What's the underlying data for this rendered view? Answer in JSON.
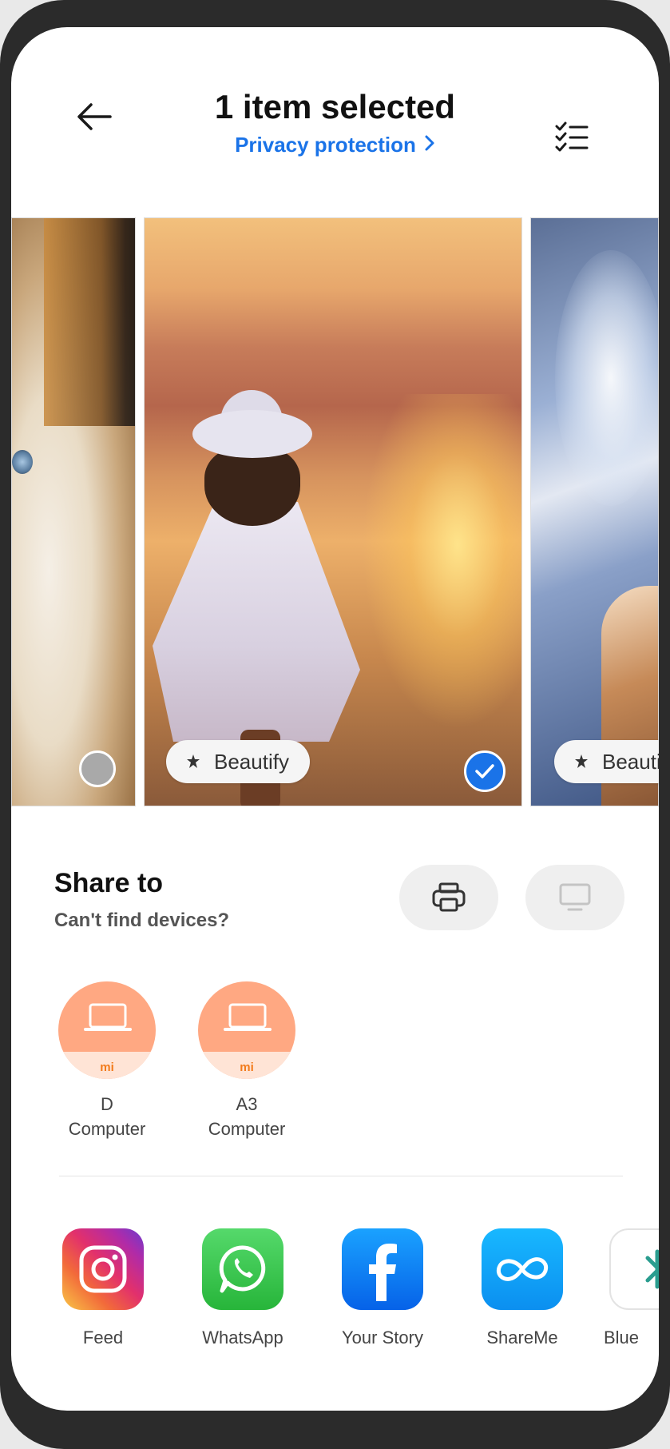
{
  "header": {
    "title": "1 item selected",
    "privacy_link": "Privacy protection",
    "back_icon": "arrow-left-icon",
    "multi_select_icon": "checklist-icon"
  },
  "photos": [
    {
      "subject": "cat",
      "selected": false
    },
    {
      "subject": "girl-at-sunset",
      "selected": true,
      "chip": "Beautify"
    },
    {
      "subject": "dog-in-water",
      "selected": false,
      "chip": "Beauti"
    }
  ],
  "share": {
    "title": "Share to",
    "subtitle": "Can't find devices?",
    "print_icon": "printer-icon",
    "screen_icon": "monitor-icon"
  },
  "devices": [
    {
      "line1": "D",
      "line2": "Computer",
      "brand": "mi",
      "icon": "laptop-icon"
    },
    {
      "line1": "A3",
      "line2": "Computer",
      "brand": "mi",
      "icon": "laptop-icon"
    }
  ],
  "apps": [
    {
      "label": "Feed",
      "icon": "instagram-icon"
    },
    {
      "label": "WhatsApp",
      "icon": "whatsapp-icon"
    },
    {
      "label": "Your Story",
      "icon": "facebook-icon"
    },
    {
      "label": "ShareMe",
      "icon": "shareme-icon"
    },
    {
      "label": "Blue",
      "icon": "bluetooth-icon"
    }
  ],
  "colors": {
    "accent": "#1a73e8",
    "device_orange": "#ffa882",
    "mi_orange": "#f27a1a"
  }
}
